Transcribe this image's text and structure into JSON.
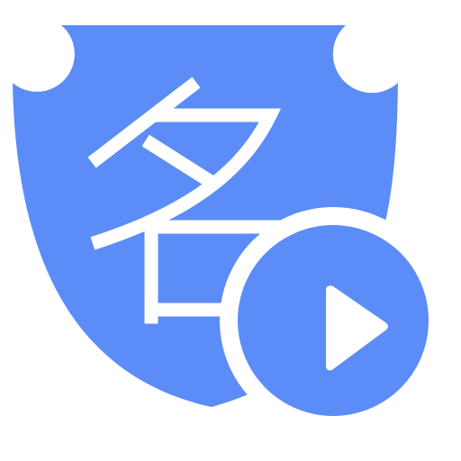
{
  "icon": {
    "name": "name-badge-play",
    "glyph": "名",
    "colors": {
      "badge": "#5b8cf7",
      "glyph": "#ffffff",
      "background": "#ffffff",
      "play_circle": "#5b8cf7",
      "play_arrow": "#ffffff"
    },
    "parts": [
      "shield-badge-icon",
      "name-glyph-icon",
      "play-circle-icon",
      "play-arrow-icon"
    ]
  }
}
